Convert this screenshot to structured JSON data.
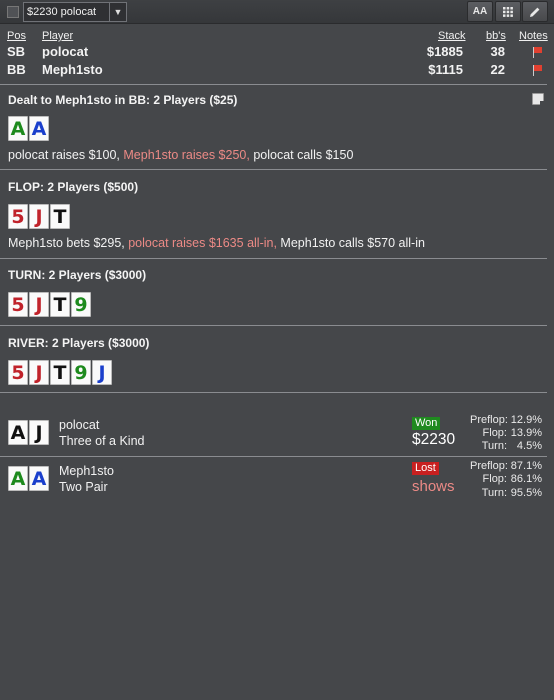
{
  "toolbar": {
    "select_value": "$2230 polocat",
    "font_button": "AA",
    "grid_icon": "grid-icon",
    "edit_icon": "pencil-icon"
  },
  "players_header": {
    "pos": "Pos",
    "player": "Player",
    "stack": "Stack",
    "bbs": "bb's",
    "notes": "Notes"
  },
  "players": [
    {
      "pos": "SB",
      "name": "polocat",
      "stack": "$1885",
      "bbs": "38"
    },
    {
      "pos": "BB",
      "name": "Meph1sto",
      "stack": "$1115",
      "bbs": "22"
    }
  ],
  "preflop": {
    "title": "Dealt to Meph1sto in BB: 2 Players ($25)",
    "cards": [
      {
        "rank": "A",
        "suit": "c"
      },
      {
        "rank": "A",
        "suit": "d"
      }
    ],
    "actions": [
      {
        "text": "polocat raises $100,",
        "hero": false
      },
      {
        "text": "Meph1sto raises $250,",
        "hero": true
      },
      {
        "text": "polocat calls $150",
        "hero": false
      }
    ]
  },
  "flop": {
    "title": "FLOP: 2 Players ($500)",
    "cards": [
      {
        "rank": "5",
        "suit": "h"
      },
      {
        "rank": "J",
        "suit": "h"
      },
      {
        "rank": "T",
        "suit": "s"
      }
    ],
    "actions": [
      {
        "text": "Meph1sto bets $295,",
        "hero": false
      },
      {
        "text": "polocat raises $1635 all-in,",
        "hero": true
      },
      {
        "text": "Meph1sto calls $570 all-in",
        "hero": false
      }
    ]
  },
  "turn": {
    "title": "TURN: 2 Players ($3000)",
    "cards": [
      {
        "rank": "5",
        "suit": "h"
      },
      {
        "rank": "J",
        "suit": "h"
      },
      {
        "rank": "T",
        "suit": "s"
      },
      {
        "rank": "9",
        "suit": "c"
      }
    ]
  },
  "river": {
    "title": "RIVER: 2 Players ($3000)",
    "cards": [
      {
        "rank": "5",
        "suit": "h"
      },
      {
        "rank": "J",
        "suit": "h"
      },
      {
        "rank": "T",
        "suit": "s"
      },
      {
        "rank": "9",
        "suit": "c"
      },
      {
        "rank": "J",
        "suit": "d"
      }
    ]
  },
  "results": [
    {
      "cards": [
        {
          "rank": "A",
          "suit": "s"
        },
        {
          "rank": "J",
          "suit": "s"
        }
      ],
      "name": "polocat",
      "hand": "Three of a Kind",
      "badge": "Won",
      "amount": "$2230",
      "equity": [
        {
          "label": "Preflop:",
          "value": "12.9%"
        },
        {
          "label": "Flop:",
          "value": "13.9%"
        },
        {
          "label": "Turn:",
          "value": "4.5%"
        }
      ]
    },
    {
      "cards": [
        {
          "rank": "A",
          "suit": "c"
        },
        {
          "rank": "A",
          "suit": "d"
        }
      ],
      "name": "Meph1sto",
      "hand": "Two Pair",
      "badge": "Lost",
      "amount": "shows",
      "equity": [
        {
          "label": "Preflop:",
          "value": "87.1%"
        },
        {
          "label": "Flop:",
          "value": "86.1%"
        },
        {
          "label": "Turn:",
          "value": "95.5%"
        }
      ]
    }
  ],
  "colors": {
    "background": "#45474a",
    "hero_action": "#ec8a86",
    "won": "#1f8a1f",
    "lost": "#c82020",
    "spade": "#111111",
    "heart": "#c0222a",
    "club": "#1d8a1d",
    "diamond": "#1a3fcc"
  }
}
